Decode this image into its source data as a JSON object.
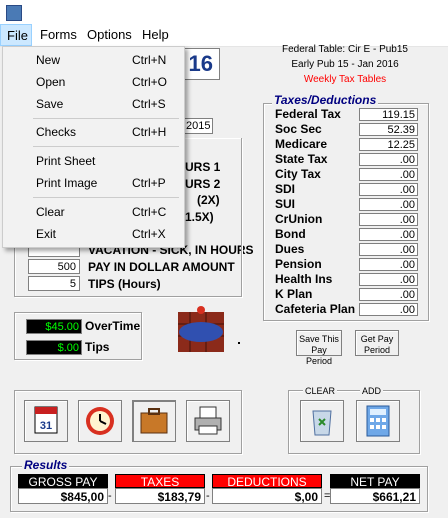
{
  "titlebar": {
    "title": ""
  },
  "menu": {
    "items": [
      "File",
      "Forms",
      "Options",
      "Help"
    ]
  },
  "file_menu": {
    "items": [
      {
        "label": "New",
        "shortcut": "Ctrl+N"
      },
      {
        "label": "Open",
        "shortcut": "Ctrl+O"
      },
      {
        "label": "Save",
        "shortcut": "Ctrl+S"
      },
      {
        "label": "Checks",
        "shortcut": "Ctrl+H"
      },
      {
        "label": "Print Sheet",
        "shortcut": ""
      },
      {
        "label": "Print Image",
        "shortcut": "Ctrl+P"
      },
      {
        "label": "Clear",
        "shortcut": "Ctrl+C"
      },
      {
        "label": "Exit",
        "shortcut": "Ctrl+X"
      }
    ]
  },
  "logo_text": "16",
  "header": {
    "line1": "Federal Table: Cir E - Pub15",
    "line2": "Early Pub 15 - Jan 2016",
    "line3": "Weekly Tax Tables"
  },
  "year_value": "2015",
  "hours": {
    "row1": "URS 1",
    "row2": "URS 2",
    "row3": "(2X)",
    "row4": "1.5X)",
    "vacation_label": "VACATION - SICK, IN HOURS",
    "pay_value": "500",
    "pay_label": "PAY IN DOLLAR AMOUNT",
    "tips_value": "5",
    "tips_label": "TIPS (Hours)"
  },
  "overtime": {
    "value": "$45.00",
    "label": "OverTime"
  },
  "tips": {
    "value": "$.00",
    "label": "Tips"
  },
  "taxes": {
    "title": "Taxes/Deductions",
    "rows": [
      {
        "label": "Federal Tax",
        "value": "119.15"
      },
      {
        "label": "Soc Sec",
        "value": "52.39"
      },
      {
        "label": "Medicare",
        "value": "12.25"
      },
      {
        "label": "State Tax",
        "value": ".00"
      },
      {
        "label": "City Tax",
        "value": ".00"
      },
      {
        "label": "SDI",
        "value": ".00"
      },
      {
        "label": "SUI",
        "value": ".00"
      },
      {
        "label": "CrUnion",
        "value": ".00"
      },
      {
        "label": "Bond",
        "value": ".00"
      },
      {
        "label": "Dues",
        "value": ".00"
      },
      {
        "label": "Pension",
        "value": ".00"
      },
      {
        "label": "Health Ins",
        "value": ".00"
      },
      {
        "label": "K Plan",
        "value": ".00"
      },
      {
        "label": "Cafeteria Plan",
        "value": ".00"
      }
    ]
  },
  "buttons": {
    "save_pay_period": "Save This Pay Period",
    "get_pay_period": "Get Pay Period",
    "clear": "CLEAR",
    "add": "ADD"
  },
  "results": {
    "title": "Results",
    "gross_label": "GROSS PAY",
    "gross_value": "$845,00",
    "taxes_label": "TAXES",
    "taxes_value": "$183,79",
    "deductions_label": "DEDUCTIONS",
    "deductions_value": "$,00",
    "net_label": "NET PAY",
    "net_value": "$661,21",
    "op_minus1": "-",
    "op_minus2": "-",
    "op_equals": "="
  },
  "colors": {
    "red": "#ff0000",
    "lcd_green": "#00ff00",
    "title_blue": "#000080"
  }
}
